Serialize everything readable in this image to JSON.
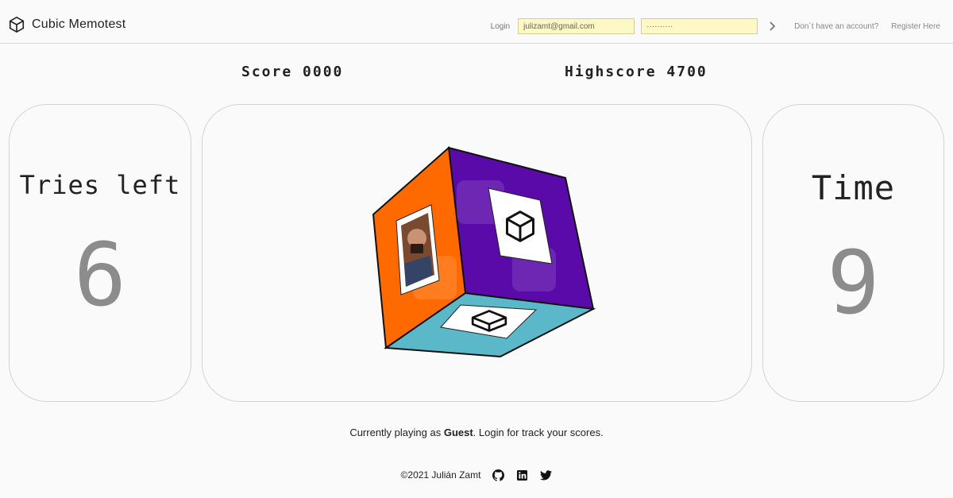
{
  "header": {
    "app_title": "Cubic Memotest",
    "login_label": "Login",
    "email_value": "julizamt@gmail.com",
    "password_value": "··········",
    "no_account_text": "Don´t have an account?",
    "register_link": "Register Here"
  },
  "scoreboard": {
    "score_label": "Score",
    "score_value": "0000",
    "highscore_label": "Highscore",
    "highscore_value": "4700"
  },
  "left_panel": {
    "title": "Tries left",
    "value": "6"
  },
  "right_panel": {
    "title": "Time",
    "value": "9"
  },
  "cube": {
    "face_colors": {
      "left": "#ff6a00",
      "top": "#5a0aa8",
      "bottom": "#5bb8c8"
    },
    "faces": [
      "photo-card",
      "cube-icon-card",
      "cube-icon-card"
    ]
  },
  "status": {
    "prefix": "Currently playing as",
    "user": "Guest",
    "suffix": ". Login for track your scores."
  },
  "footer": {
    "copyright": "©2021 Julián Zamt",
    "icons": [
      "github-icon",
      "linkedin-icon",
      "twitter-icon"
    ]
  }
}
